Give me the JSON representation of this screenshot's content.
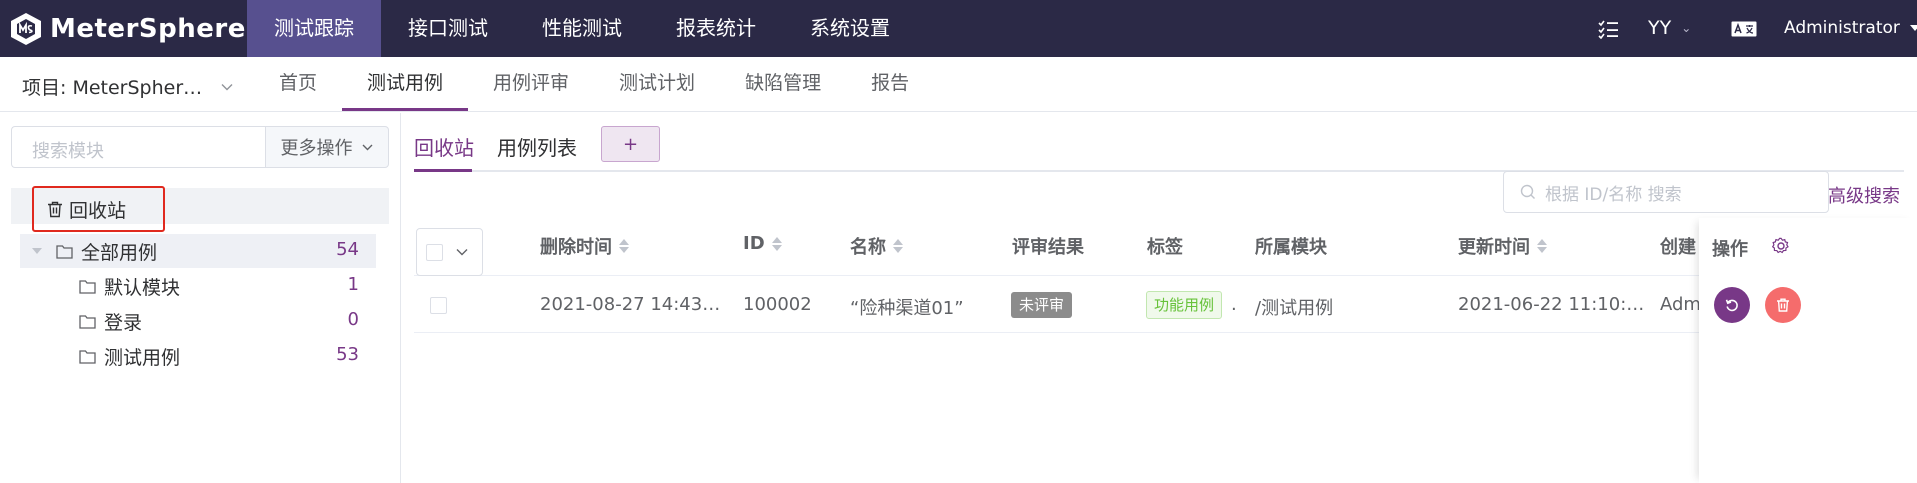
{
  "app": {
    "brand": "MeterSphere",
    "brand_color": "#2b2946",
    "accent_color": "#783887"
  },
  "top_menu": [
    {
      "label": "测试跟踪",
      "active": true
    },
    {
      "label": "接口测试",
      "active": false
    },
    {
      "label": "性能测试",
      "active": false
    },
    {
      "label": "报表统计",
      "active": false
    },
    {
      "label": "系统设置",
      "active": false
    }
  ],
  "top_right": {
    "tasks_icon": "task-list-icon",
    "workspace": "YY",
    "lang_icon": "translate-icon",
    "user": "Administrator"
  },
  "subnav": {
    "project": "项目: MeterSpher…",
    "items": [
      {
        "label": "首页",
        "active": false
      },
      {
        "label": "测试用例",
        "active": true
      },
      {
        "label": "用例评审",
        "active": false
      },
      {
        "label": "测试计划",
        "active": false
      },
      {
        "label": "缺陷管理",
        "active": false
      },
      {
        "label": "报告",
        "active": false
      }
    ]
  },
  "sidebar": {
    "search_placeholder": "搜索模块",
    "more_ops": "更多操作",
    "trash": "回收站",
    "tree": [
      {
        "label": "全部用例",
        "count": "54"
      },
      {
        "label": "默认模块",
        "count": "1"
      },
      {
        "label": "登录",
        "count": "0"
      },
      {
        "label": "测试用例",
        "count": "53"
      }
    ]
  },
  "main": {
    "tabs": [
      {
        "label": "回收站",
        "active": true
      },
      {
        "label": "用例列表",
        "active": false
      }
    ],
    "add_tab": "+",
    "search_placeholder": "根据 ID/名称 搜索",
    "advanced_search": "高级搜索"
  },
  "table": {
    "columns": [
      "删除时间",
      "ID",
      "名称",
      "评审结果",
      "标签",
      "所属模块",
      "更新时间",
      "创建"
    ],
    "operation_header": "操作",
    "rows": [
      {
        "deleted_at": "2021-08-27 14:43…",
        "id": "100002",
        "name": "“险种渠道01”",
        "review": "未评审",
        "tag": "功能用例",
        "tag_more": ".",
        "module": "/测试用例",
        "updated_at": "2021-06-22 11:10:…",
        "creator": "Adm"
      }
    ]
  }
}
